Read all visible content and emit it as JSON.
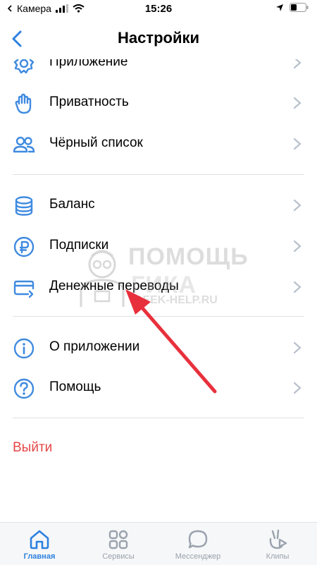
{
  "status": {
    "carrier": "Камера",
    "time": "15:26"
  },
  "header": {
    "title": "Настройки"
  },
  "menu": [
    {
      "label": "Приложение",
      "icon": "gear-icon"
    },
    {
      "label": "Приватность",
      "icon": "hand-icon"
    },
    {
      "label": "Чёрный список",
      "icon": "people-icon"
    },
    {
      "label": "Баланс",
      "icon": "coins-icon"
    },
    {
      "label": "Подписки",
      "icon": "ruble-icon"
    },
    {
      "label": "Денежные переводы",
      "icon": "card-transfer-icon"
    },
    {
      "label": "О приложении",
      "icon": "info-icon"
    },
    {
      "label": "Помощь",
      "icon": "question-icon"
    }
  ],
  "logout": "Выйти",
  "watermark": {
    "line1": "ПОМОЩЬ",
    "line2": "ГИКА",
    "line3": "GEEK-HELP.RU"
  },
  "tabs": [
    {
      "label": "Главная",
      "icon": "home-icon",
      "active": true
    },
    {
      "label": "Сервисы",
      "icon": "services-icon"
    },
    {
      "label": "Мессенджер",
      "icon": "messenger-icon"
    },
    {
      "label": "Клипы",
      "icon": "clips-icon"
    }
  ],
  "colors": {
    "accent": "#2d81e0",
    "icon": "#3f8ae0",
    "danger": "#e64646",
    "arrow": "#e8303c"
  }
}
